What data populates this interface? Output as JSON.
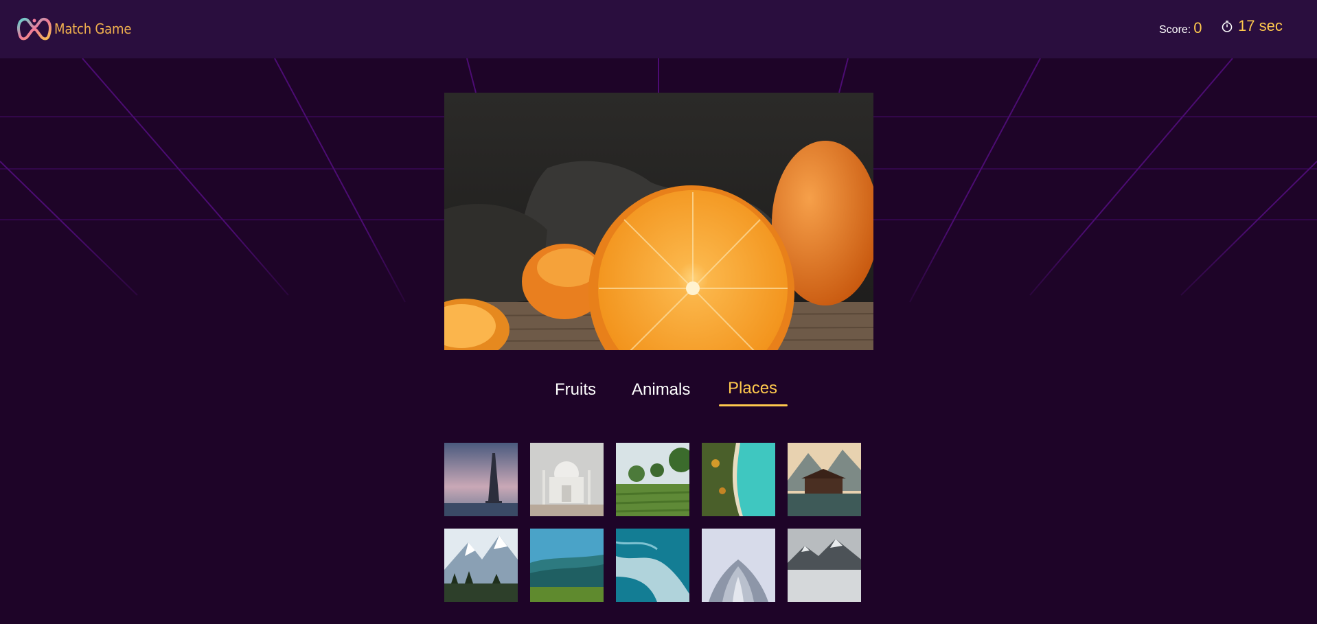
{
  "app": {
    "logo_text": "Match Game"
  },
  "header": {
    "score_label": "Score:",
    "score_value": "0",
    "timer_text": "17 sec"
  },
  "tabs": [
    {
      "label": "Fruits",
      "active": false
    },
    {
      "label": "Animals",
      "active": false
    },
    {
      "label": "Places",
      "active": true
    }
  ],
  "main_image": {
    "subject": "halved orange and whole oranges on a wooden table"
  },
  "thumbnails": [
    {
      "subject": "eiffel tower"
    },
    {
      "subject": "taj mahal"
    },
    {
      "subject": "green tea plantation"
    },
    {
      "subject": "aerial coastline beach"
    },
    {
      "subject": "lakeside wooden house with mountains"
    },
    {
      "subject": "snowy mountains with forest"
    },
    {
      "subject": "green valley with hills"
    },
    {
      "subject": "aerial ocean waves"
    },
    {
      "subject": "lotus temple"
    },
    {
      "subject": "misty mountain peaks"
    }
  ],
  "colors": {
    "background": "#1e0428",
    "navbar": "#2a0e3e",
    "accent": "#ffc94d",
    "grid_line": "#5a0f8a"
  }
}
